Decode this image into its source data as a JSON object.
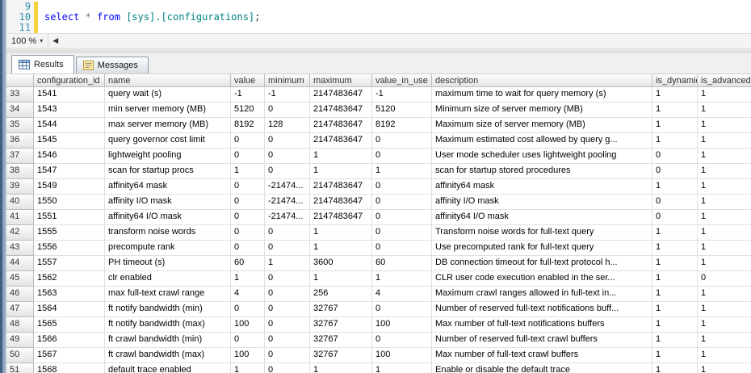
{
  "editor": {
    "line_numbers": [
      "9",
      "10",
      "11"
    ],
    "code_line_index": 1,
    "code_tokens": [
      {
        "t": "select",
        "c": "kw"
      },
      {
        "t": " ",
        "c": "pl"
      },
      {
        "t": "*",
        "c": "op"
      },
      {
        "t": " ",
        "c": "pl"
      },
      {
        "t": "from",
        "c": "kw"
      },
      {
        "t": " ",
        "c": "pl"
      },
      {
        "t": "[sys].[configurations]",
        "c": "tbl"
      },
      {
        "t": ";",
        "c": "pl"
      }
    ],
    "zoom": "100 %"
  },
  "tabs": [
    {
      "label": "Results",
      "active": true
    },
    {
      "label": "Messages",
      "active": false
    }
  ],
  "grid": {
    "columns": [
      "configuration_id",
      "name",
      "value",
      "minimum",
      "maximum",
      "value_in_use",
      "description",
      "is_dynamic",
      "is_advanced"
    ],
    "rows": [
      {
        "num": "33",
        "cells": [
          "1541",
          "query wait (s)",
          "-1",
          "-1",
          "2147483647",
          "-1",
          "maximum time to wait for query memory (s)",
          "1",
          "1"
        ]
      },
      {
        "num": "34",
        "cells": [
          "1543",
          "min server memory (MB)",
          "5120",
          "0",
          "2147483647",
          "5120",
          "Minimum size of server memory (MB)",
          "1",
          "1"
        ]
      },
      {
        "num": "35",
        "cells": [
          "1544",
          "max server memory (MB)",
          "8192",
          "128",
          "2147483647",
          "8192",
          "Maximum size of server memory (MB)",
          "1",
          "1"
        ]
      },
      {
        "num": "36",
        "cells": [
          "1545",
          "query governor cost limit",
          "0",
          "0",
          "2147483647",
          "0",
          "Maximum estimated cost allowed by query g...",
          "1",
          "1"
        ]
      },
      {
        "num": "37",
        "cells": [
          "1546",
          "lightweight pooling",
          "0",
          "0",
          "1",
          "0",
          "User mode scheduler uses lightweight pooling",
          "0",
          "1"
        ]
      },
      {
        "num": "38",
        "cells": [
          "1547",
          "scan for startup procs",
          "1",
          "0",
          "1",
          "1",
          "scan for startup stored procedures",
          "0",
          "1"
        ]
      },
      {
        "num": "39",
        "cells": [
          "1549",
          "affinity64 mask",
          "0",
          "-21474...",
          "2147483647",
          "0",
          "affinity64 mask",
          "1",
          "1"
        ]
      },
      {
        "num": "40",
        "cells": [
          "1550",
          "affinity I/O mask",
          "0",
          "-21474...",
          "2147483647",
          "0",
          "affinity I/O mask",
          "0",
          "1"
        ]
      },
      {
        "num": "41",
        "cells": [
          "1551",
          "affinity64 I/O mask",
          "0",
          "-21474...",
          "2147483647",
          "0",
          "affinity64 I/O mask",
          "0",
          "1"
        ]
      },
      {
        "num": "42",
        "cells": [
          "1555",
          "transform noise words",
          "0",
          "0",
          "1",
          "0",
          "Transform noise words for full-text query",
          "1",
          "1"
        ]
      },
      {
        "num": "43",
        "cells": [
          "1556",
          "precompute rank",
          "0",
          "0",
          "1",
          "0",
          "Use precomputed rank for full-text query",
          "1",
          "1"
        ]
      },
      {
        "num": "44",
        "cells": [
          "1557",
          "PH timeout (s)",
          "60",
          "1",
          "3600",
          "60",
          "DB connection timeout for full-text protocol h...",
          "1",
          "1"
        ]
      },
      {
        "num": "45",
        "cells": [
          "1562",
          "clr enabled",
          "1",
          "0",
          "1",
          "1",
          "CLR user code execution enabled in the ser...",
          "1",
          "0"
        ]
      },
      {
        "num": "46",
        "cells": [
          "1563",
          "max full-text crawl range",
          "4",
          "0",
          "256",
          "4",
          "Maximum  crawl ranges allowed in full-text in...",
          "1",
          "1"
        ]
      },
      {
        "num": "47",
        "cells": [
          "1564",
          "ft notify bandwidth (min)",
          "0",
          "0",
          "32767",
          "0",
          "Number of reserved full-text notifications buff...",
          "1",
          "1"
        ]
      },
      {
        "num": "48",
        "cells": [
          "1565",
          "ft notify bandwidth (max)",
          "100",
          "0",
          "32767",
          "100",
          "Max number of full-text notifications buffers",
          "1",
          "1"
        ]
      },
      {
        "num": "49",
        "cells": [
          "1566",
          "ft crawl bandwidth (min)",
          "0",
          "0",
          "32767",
          "0",
          "Number of reserved full-text crawl buffers",
          "1",
          "1"
        ]
      },
      {
        "num": "50",
        "cells": [
          "1567",
          "ft crawl bandwidth (max)",
          "100",
          "0",
          "32767",
          "100",
          "Max number of full-text crawl buffers",
          "1",
          "1"
        ]
      },
      {
        "num": "51",
        "cells": [
          "1568",
          "default trace enabled",
          "1",
          "0",
          "1",
          "1",
          "Enable or disable the default trace",
          "1",
          "1"
        ]
      }
    ]
  }
}
